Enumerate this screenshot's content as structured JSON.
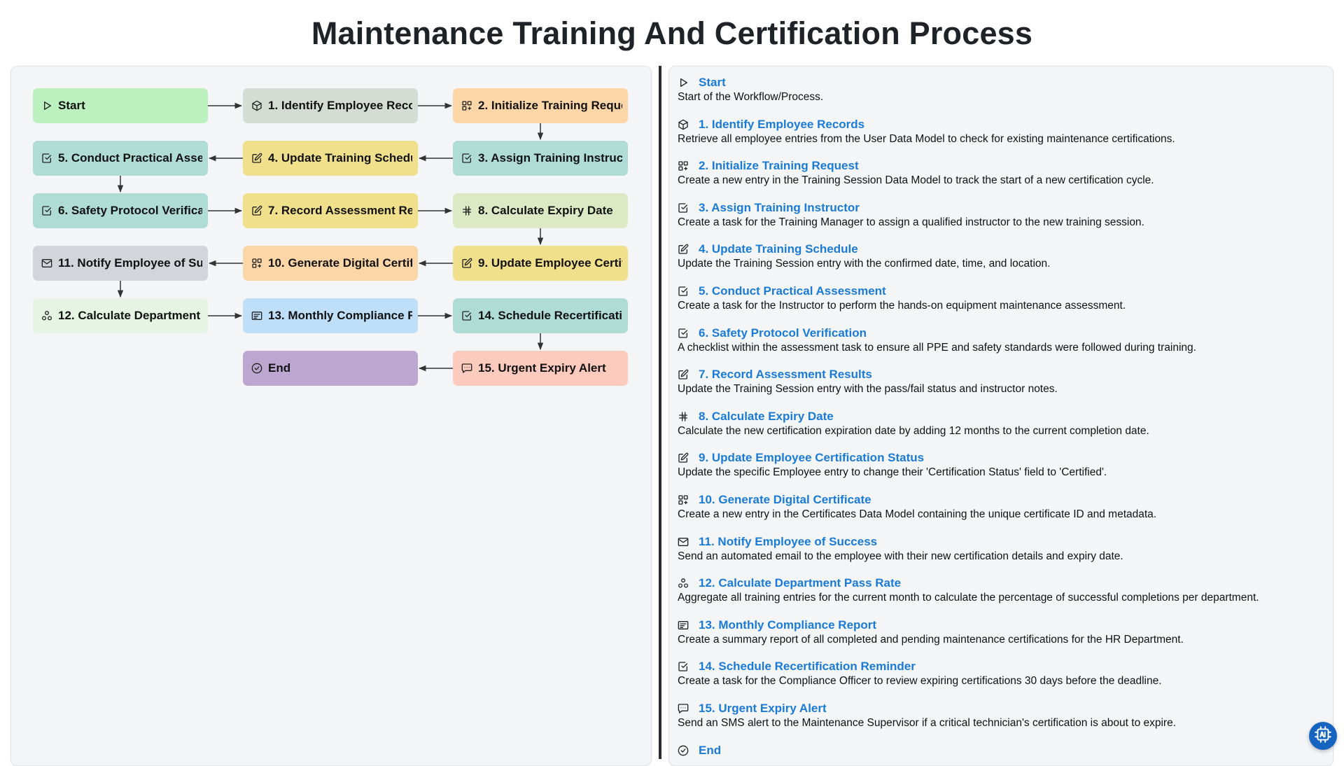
{
  "title": "Maintenance Training And Certification Process",
  "nodes": [
    {
      "label": "Start",
      "icon": "play-icon",
      "color": "#bdf0bf"
    },
    {
      "label": "1. Identify Employee Records",
      "icon": "cube-icon",
      "color": "#d4dcd4"
    },
    {
      "label": "2. Initialize Training Request",
      "icon": "grid-plus-icon",
      "color": "#fdd6a8"
    },
    {
      "label": "3. Assign Training Instructor",
      "icon": "checkbox-icon",
      "color": "#b0dcd6"
    },
    {
      "label": "4. Update Training Schedule",
      "icon": "edit-icon",
      "color": "#f0e08c"
    },
    {
      "label": "5. Conduct Practical Assessment",
      "icon": "checkbox-icon",
      "color": "#b0dcd6"
    },
    {
      "label": "6. Safety Protocol Verification",
      "icon": "checkbox-icon",
      "color": "#b0dcd6"
    },
    {
      "label": "7. Record Assessment Results",
      "icon": "edit-icon",
      "color": "#f0e08c"
    },
    {
      "label": "8. Calculate Expiry Date",
      "icon": "hash-icon",
      "color": "#dde9c5"
    },
    {
      "label": "9. Update Employee Certification Status",
      "icon": "edit-icon",
      "color": "#f0e08c"
    },
    {
      "label": "10. Generate Digital Certificate",
      "icon": "grid-plus-icon",
      "color": "#fdd6a8"
    },
    {
      "label": "11. Notify Employee of Success",
      "icon": "mail-icon",
      "color": "#d2d5d9"
    },
    {
      "label": "12. Calculate Department Pass Rate",
      "icon": "share-icon",
      "color": "#e5f4e3"
    },
    {
      "label": "13. Monthly Compliance Report",
      "icon": "report-icon",
      "color": "#bfdef8"
    },
    {
      "label": "14. Schedule Recertification Reminder",
      "icon": "checkbox-icon",
      "color": "#b0dcd6"
    },
    {
      "label": "15. Urgent Expiry Alert",
      "icon": "sms-icon",
      "color": "#fdcbbd"
    },
    {
      "label": "End",
      "icon": "check-circle-icon",
      "color": "#bda6cf"
    }
  ],
  "steps": [
    {
      "title": "Start",
      "desc": "Start of the Workflow/Process.",
      "icon": "play-icon"
    },
    {
      "title": "1. Identify Employee Records",
      "desc": "Retrieve all employee entries from the User Data Model to check for existing maintenance certifications.",
      "icon": "cube-icon"
    },
    {
      "title": "2. Initialize Training Request",
      "desc": "Create a new entry in the Training Session Data Model to track the start of a new certification cycle.",
      "icon": "grid-plus-icon"
    },
    {
      "title": "3. Assign Training Instructor",
      "desc": "Create a task for the Training Manager to assign a qualified instructor to the new training session.",
      "icon": "checkbox-icon"
    },
    {
      "title": "4. Update Training Schedule",
      "desc": "Update the Training Session entry with the confirmed date, time, and location.",
      "icon": "edit-icon"
    },
    {
      "title": "5. Conduct Practical Assessment",
      "desc": "Create a task for the Instructor to perform the hands-on equipment maintenance assessment.",
      "icon": "checkbox-icon"
    },
    {
      "title": "6. Safety Protocol Verification",
      "desc": "A checklist within the assessment task to ensure all PPE and safety standards were followed during training.",
      "icon": "checkbox-icon"
    },
    {
      "title": "7. Record Assessment Results",
      "desc": "Update the Training Session entry with the pass/fail status and instructor notes.",
      "icon": "edit-icon"
    },
    {
      "title": "8. Calculate Expiry Date",
      "desc": "Calculate the new certification expiration date by adding 12 months to the current completion date.",
      "icon": "hash-icon"
    },
    {
      "title": "9. Update Employee Certification Status",
      "desc": "Update the specific Employee entry to change their 'Certification Status' field to 'Certified'.",
      "icon": "edit-icon"
    },
    {
      "title": "10. Generate Digital Certificate",
      "desc": "Create a new entry in the Certificates Data Model containing the unique certificate ID and metadata.",
      "icon": "grid-plus-icon"
    },
    {
      "title": "11. Notify Employee of Success",
      "desc": "Send an automated email to the employee with their new certification details and expiry date.",
      "icon": "mail-icon"
    },
    {
      "title": "12. Calculate Department Pass Rate",
      "desc": "Aggregate all training entries for the current month to calculate the percentage of successful completions per department.",
      "icon": "share-icon"
    },
    {
      "title": "13. Monthly Compliance Report",
      "desc": "Create a summary report of all completed and pending maintenance certifications for the HR Department.",
      "icon": "report-icon"
    },
    {
      "title": "14. Schedule Recertification Reminder",
      "desc": "Create a task for the Compliance Officer to review expiring certifications 30 days before the deadline.",
      "icon": "checkbox-icon"
    },
    {
      "title": "15. Urgent Expiry Alert",
      "desc": "Send an SMS alert to the Maintenance Supervisor if a critical technician's certification is about to expire.",
      "icon": "sms-icon"
    },
    {
      "title": "End",
      "desc": "",
      "icon": "check-circle-icon"
    }
  ],
  "fab": {
    "icon": "ai-chip-icon",
    "color": "#1565c0"
  }
}
